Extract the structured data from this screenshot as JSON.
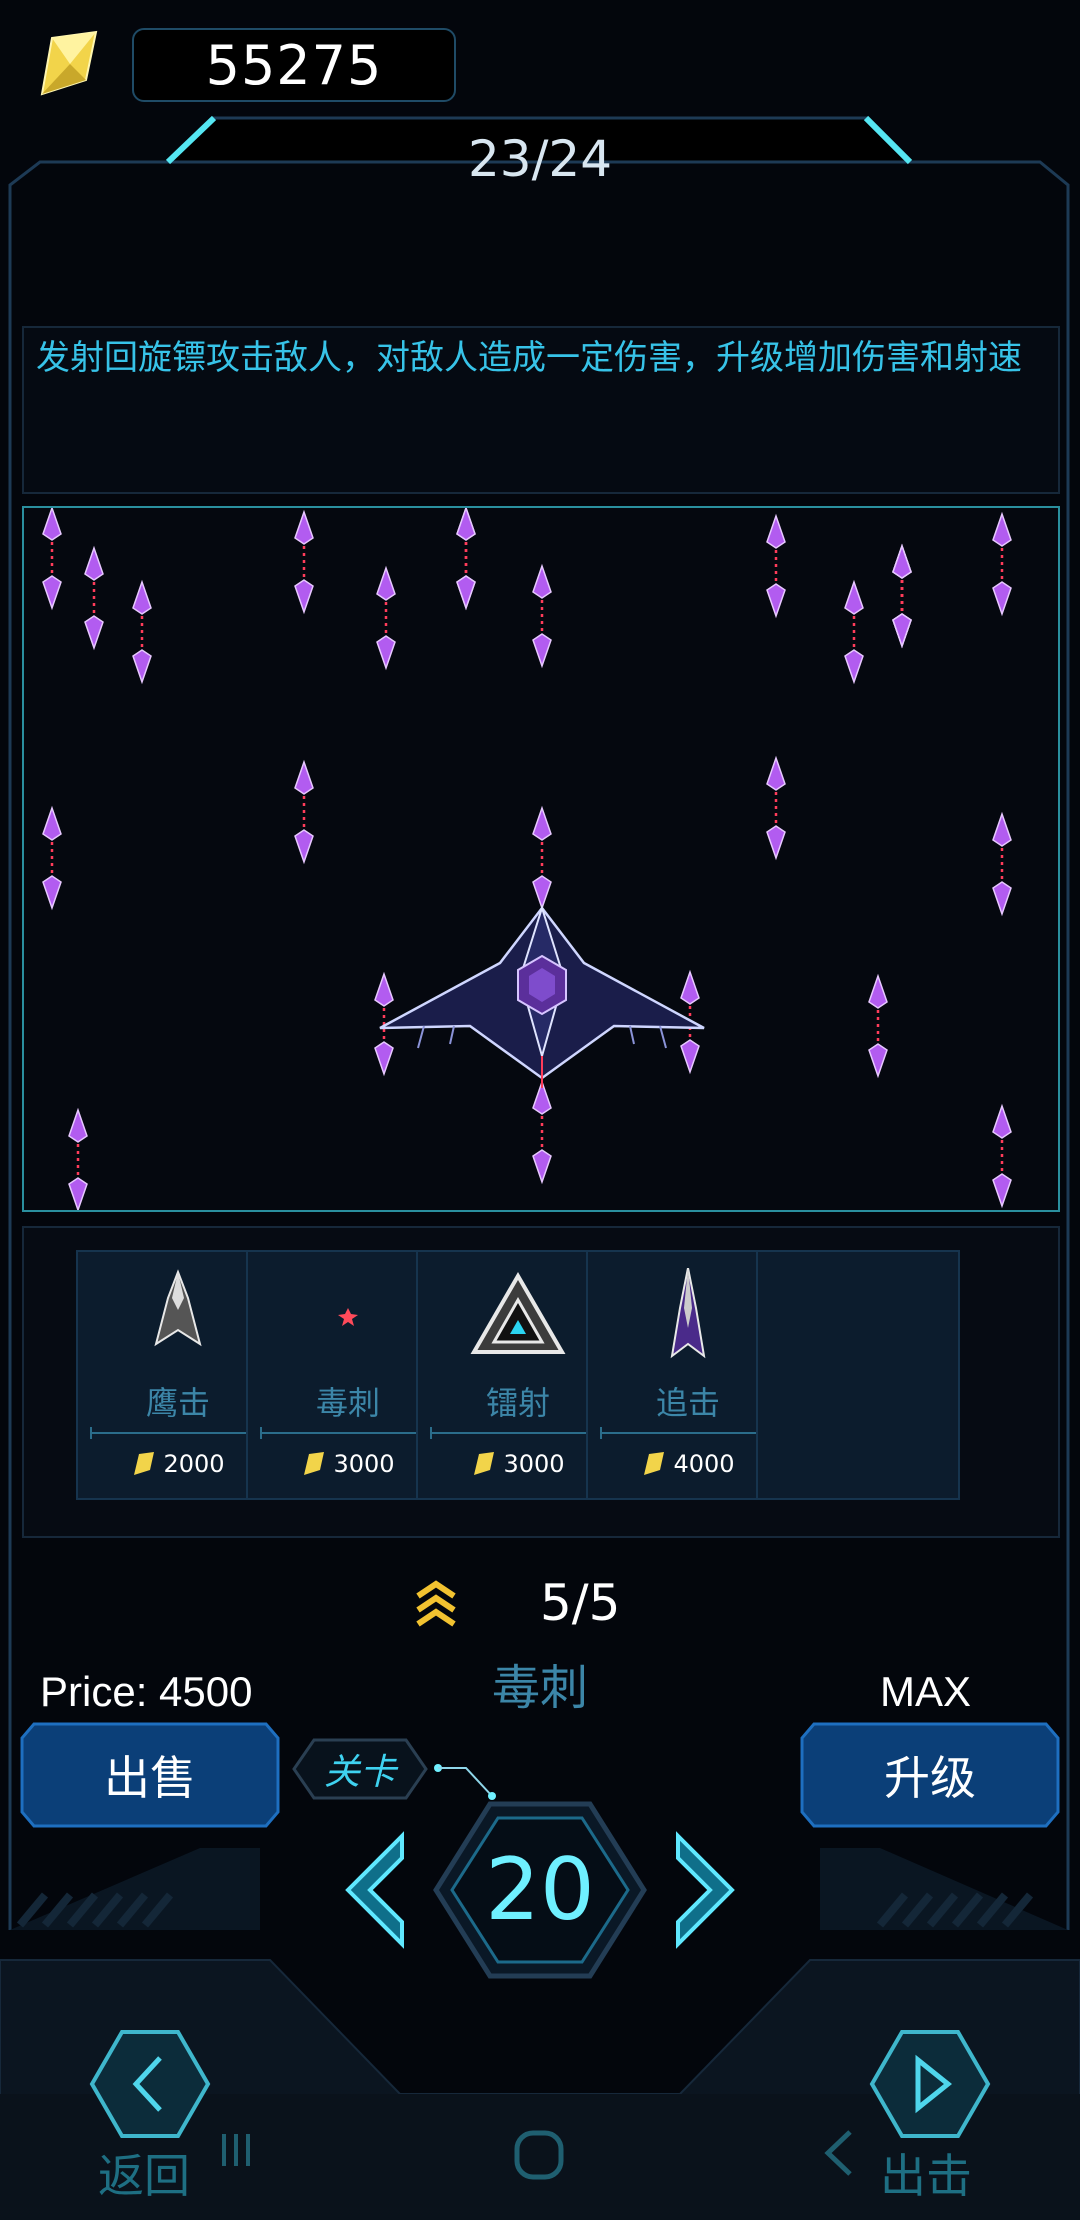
{
  "currency": {
    "amount": "55275",
    "icon": "gem-icon"
  },
  "collection": {
    "count": "23/24"
  },
  "description": "发射回旋镖攻击敌人，对敌人造成一定伤害，升级增加伤害和射速",
  "shop": {
    "items": [
      {
        "name": "鹰击",
        "price": "2000",
        "icon": "eagle-ship-icon"
      },
      {
        "name": "毒刺",
        "price": "3000",
        "icon": "stinger-icon"
      },
      {
        "name": "镭射",
        "price": "3000",
        "icon": "laser-triangle-icon"
      },
      {
        "name": "追击",
        "price": "4000",
        "icon": "chaser-ship-icon"
      }
    ]
  },
  "selected": {
    "level": "5/5",
    "name": "毒刺",
    "price_text": "Price: 4500",
    "max_text": "MAX"
  },
  "buttons": {
    "sell": "出售",
    "upgrade": "升级",
    "stage_tag": "关卡",
    "stage_number": "20",
    "back": "返回",
    "go": "出击"
  },
  "colors": {
    "accent": "#37c3e8",
    "projectile": "#b25cf0",
    "gem": "#f2d44a"
  }
}
